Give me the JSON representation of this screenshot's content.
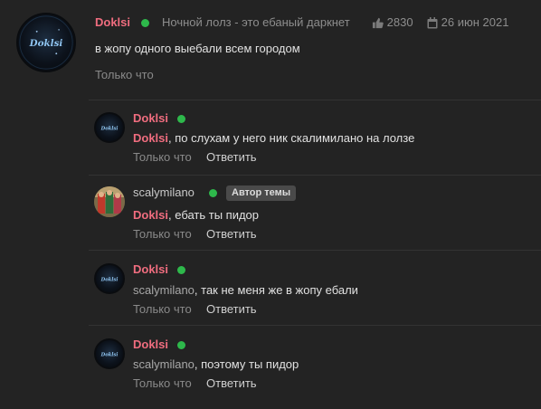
{
  "post": {
    "author": "Doklsi",
    "thread": "Ночной лолз - это ебаный даркнет",
    "likes": "2830",
    "date": "26 июн 2021",
    "text": "в жопу одного выебали всем городом",
    "time": "Только что",
    "avatar_text": "Doklsi"
  },
  "comments": [
    {
      "author": "Doklsi",
      "mention": "Doklsi",
      "text": ", по слухам у него ник скалимилано на лолзе",
      "time": "Только что",
      "reply": "Ответить",
      "avatar_text": "Doklsi"
    },
    {
      "author": "scalymilano",
      "badge": "Автор темы",
      "mention": "Doklsi",
      "text": ", ебать ты пидор",
      "time": "Только что",
      "reply": "Ответить"
    },
    {
      "author": "Doklsi",
      "mention": "scalymilano",
      "text": ", так не меня же в жопу ебали",
      "time": "Только что",
      "reply": "Ответить",
      "avatar_text": "Doklsi"
    },
    {
      "author": "Doklsi",
      "mention": "scalymilano",
      "text": ", поэтому ты пидор",
      "time": "Только что",
      "reply": "Ответить",
      "avatar_text": "Doklsi"
    }
  ],
  "colors": {
    "background": "#232323",
    "username": "#f06d7f",
    "online": "#2eb84b"
  }
}
